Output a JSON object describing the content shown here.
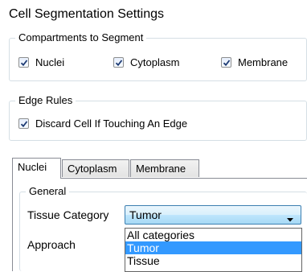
{
  "title": "Cell Segmentation Settings",
  "compartments": {
    "legend": "Compartments to Segment",
    "items": [
      {
        "label": "Nuclei",
        "checked": true
      },
      {
        "label": "Cytoplasm",
        "checked": true
      },
      {
        "label": "Membrane",
        "checked": true
      }
    ]
  },
  "edge_rules": {
    "legend": "Edge Rules",
    "discard_label": "Discard Cell If Touching An Edge",
    "checked": true
  },
  "tabs": [
    {
      "label": "Nuclei",
      "active": true
    },
    {
      "label": "Cytoplasm",
      "active": false
    },
    {
      "label": "Membrane",
      "active": false
    }
  ],
  "general": {
    "legend": "General",
    "tissue_category_label": "Tissue Category",
    "tissue_category_value": "Tumor",
    "approach_label": "Approach",
    "options": [
      "All categories",
      "Tumor",
      "Tissue"
    ],
    "selected_option": "Tumor"
  }
}
